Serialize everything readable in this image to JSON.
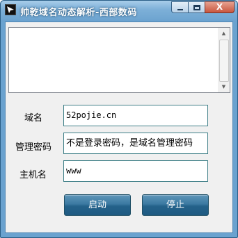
{
  "window": {
    "title": "帅乾域名动态解析-西部数码",
    "close_glyph": "X"
  },
  "log": {
    "text": ""
  },
  "form": {
    "domain_label": "域名",
    "domain_value": "52pojie.cn",
    "password_label": "管理密码",
    "password_value": "不是登录密码，是域名管理密码",
    "host_label": "主机名",
    "host_value": "www"
  },
  "buttons": {
    "start": "启动",
    "stop": "停止"
  },
  "colors": {
    "titlebar": "#7db0d8",
    "button": "#2f6d95"
  }
}
